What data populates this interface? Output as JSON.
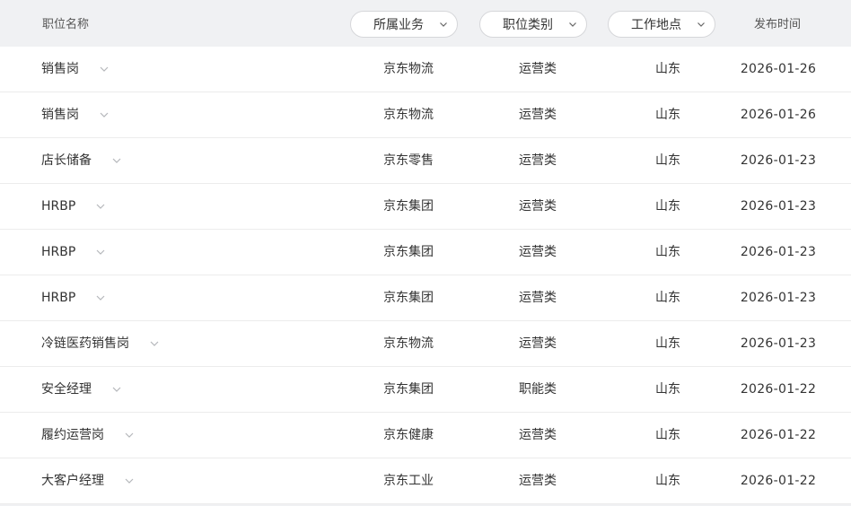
{
  "header": {
    "title_col": "职位名称",
    "business_filter": "所属业务",
    "category_filter": "职位类别",
    "location_filter": "工作地点",
    "date_col": "发布时间"
  },
  "icons": {
    "filter_chevron": "chevron-down-icon",
    "row_expand": "chevron-down-icon"
  },
  "colors": {
    "header_bg": "#f0f1f3",
    "text": "#333333",
    "divider": "#ececec",
    "chevron": "#b5b7bb"
  },
  "rows": [
    {
      "title": "销售岗",
      "business": "京东物流",
      "category": "运营类",
      "location": "山东",
      "date": "2026-01-26"
    },
    {
      "title": "销售岗",
      "business": "京东物流",
      "category": "运营类",
      "location": "山东",
      "date": "2026-01-26"
    },
    {
      "title": "店长储备",
      "business": "京东零售",
      "category": "运营类",
      "location": "山东",
      "date": "2026-01-23"
    },
    {
      "title": "HRBP",
      "business": "京东集团",
      "category": "运营类",
      "location": "山东",
      "date": "2026-01-23"
    },
    {
      "title": "HRBP",
      "business": "京东集团",
      "category": "运营类",
      "location": "山东",
      "date": "2026-01-23"
    },
    {
      "title": "HRBP",
      "business": "京东集团",
      "category": "运营类",
      "location": "山东",
      "date": "2026-01-23"
    },
    {
      "title": "冷链医药销售岗",
      "business": "京东物流",
      "category": "运营类",
      "location": "山东",
      "date": "2026-01-23"
    },
    {
      "title": "安全经理",
      "business": "京东集团",
      "category": "职能类",
      "location": "山东",
      "date": "2026-01-22"
    },
    {
      "title": "履约运营岗",
      "business": "京东健康",
      "category": "运营类",
      "location": "山东",
      "date": "2026-01-22"
    },
    {
      "title": "大客户经理",
      "business": "京东工业",
      "category": "运营类",
      "location": "山东",
      "date": "2026-01-22"
    }
  ]
}
